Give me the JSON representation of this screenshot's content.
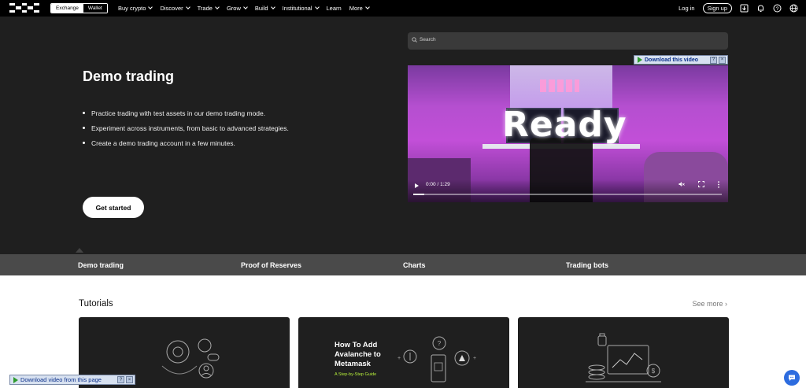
{
  "nav": {
    "toggle": {
      "exchange": "Exchange",
      "wallet": "Wallet"
    },
    "menu": [
      {
        "label": "Buy crypto",
        "dropdown": true
      },
      {
        "label": "Discover",
        "dropdown": true
      },
      {
        "label": "Trade",
        "dropdown": true
      },
      {
        "label": "Grow",
        "dropdown": true
      },
      {
        "label": "Build",
        "dropdown": true
      },
      {
        "label": "Institutional",
        "dropdown": true
      },
      {
        "label": "Learn",
        "dropdown": false
      },
      {
        "label": "More",
        "dropdown": true
      }
    ],
    "login": "Log in",
    "signup": "Sign up",
    "icons": [
      "download-app-icon",
      "bell-icon",
      "help-icon",
      "globe-icon"
    ]
  },
  "hero": {
    "title": "Demo trading",
    "bullets": [
      "Practice trading with test assets in our demo trading mode.",
      "Experiment across instruments, from basic to advanced strategies.",
      "Create a demo trading account in a few minutes."
    ],
    "cta": "Get started"
  },
  "search": {
    "placeholder": "Search"
  },
  "video": {
    "overlay_text": "Ready",
    "time": "0:00 / 1:29",
    "download_bar": "Download this video",
    "progress": 0.0
  },
  "tabs": [
    "Demo trading",
    "Proof of Reserves",
    "Charts",
    "Trading bots"
  ],
  "tutorials": {
    "title": "Tutorials",
    "see_more": "See more ›",
    "cards": [
      {
        "title": "",
        "subtitle": ""
      },
      {
        "title": "How To Add Avalanche to Metamask",
        "subtitle": "A Step-by-Step Guide"
      },
      {
        "title": "",
        "subtitle": ""
      }
    ]
  },
  "download_bottom": "Download video from this page",
  "download_q": "?",
  "download_x": "×",
  "colors": {
    "hero_bg": "#1f1f1f",
    "tabs_bg": "#4a4a4a",
    "accent_green": "#b9f23b",
    "chat_blue": "#2d6cdf"
  }
}
